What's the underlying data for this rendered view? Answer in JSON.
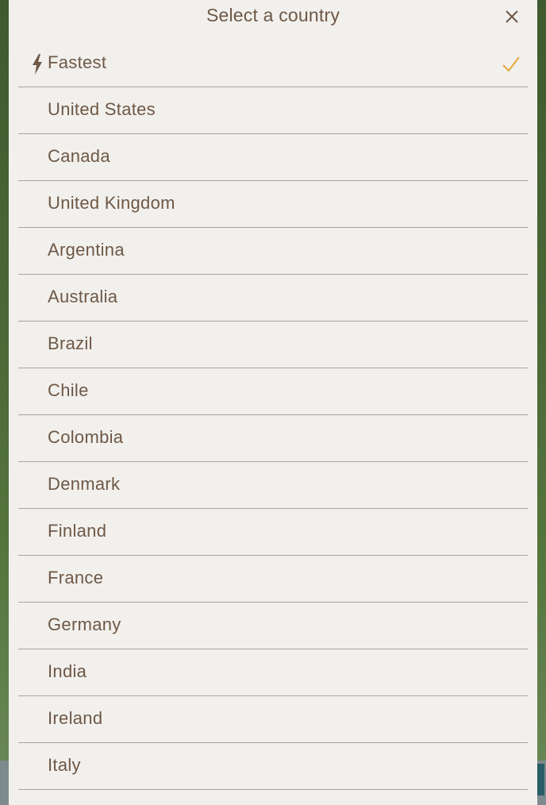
{
  "dialog": {
    "title": "Select a country",
    "close_icon": "close-icon"
  },
  "colors": {
    "text": "#6e5846",
    "accent_check": "#e0a93c",
    "divider": "#a8a4a0",
    "panel_background": "#f2f0ed"
  },
  "countries": [
    {
      "label": "Fastest",
      "icon": "lightning-bolt-icon",
      "selected": true
    },
    {
      "label": "United States"
    },
    {
      "label": "Canada"
    },
    {
      "label": "United Kingdom"
    },
    {
      "label": "Argentina"
    },
    {
      "label": "Australia"
    },
    {
      "label": "Brazil"
    },
    {
      "label": "Chile"
    },
    {
      "label": "Colombia"
    },
    {
      "label": "Denmark"
    },
    {
      "label": "Finland"
    },
    {
      "label": "France"
    },
    {
      "label": "Germany"
    },
    {
      "label": "India"
    },
    {
      "label": "Ireland"
    },
    {
      "label": "Italy"
    }
  ]
}
